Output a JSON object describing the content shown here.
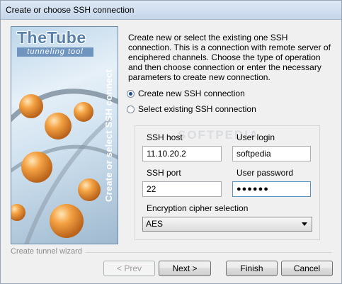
{
  "window": {
    "title": "Create or choose SSH connection"
  },
  "banner": {
    "logo_title": "TheTube",
    "logo_subtitle": "tunneling tool",
    "vertical_caption": "Create or select SSH connect"
  },
  "description": "Create new or select the existing one SSH connection. This is a connection with remote server of enciphered channels. Choose the type of operation and then choose connection or enter the necessary parameters to create new connection.",
  "options": {
    "create_new": "Create new SSH connection",
    "select_existing": "Select existing SSH connection",
    "selected": "create_new"
  },
  "form": {
    "ssh_host_label": "SSH host",
    "ssh_host_value": "11.10.20.2",
    "user_login_label": "User login",
    "user_login_value": "softpedia",
    "ssh_port_label": "SSH port",
    "ssh_port_value": "22",
    "user_password_label": "User password",
    "user_password_value": "●●●●●●",
    "cipher_label": "Encryption cipher selection",
    "cipher_value": "AES"
  },
  "footer": {
    "wizard_label": "Create tunnel wizard",
    "prev": "< Prev",
    "next": "Next >",
    "finish": "Finish",
    "cancel": "Cancel"
  },
  "watermark": "SOFTPEDIA"
}
